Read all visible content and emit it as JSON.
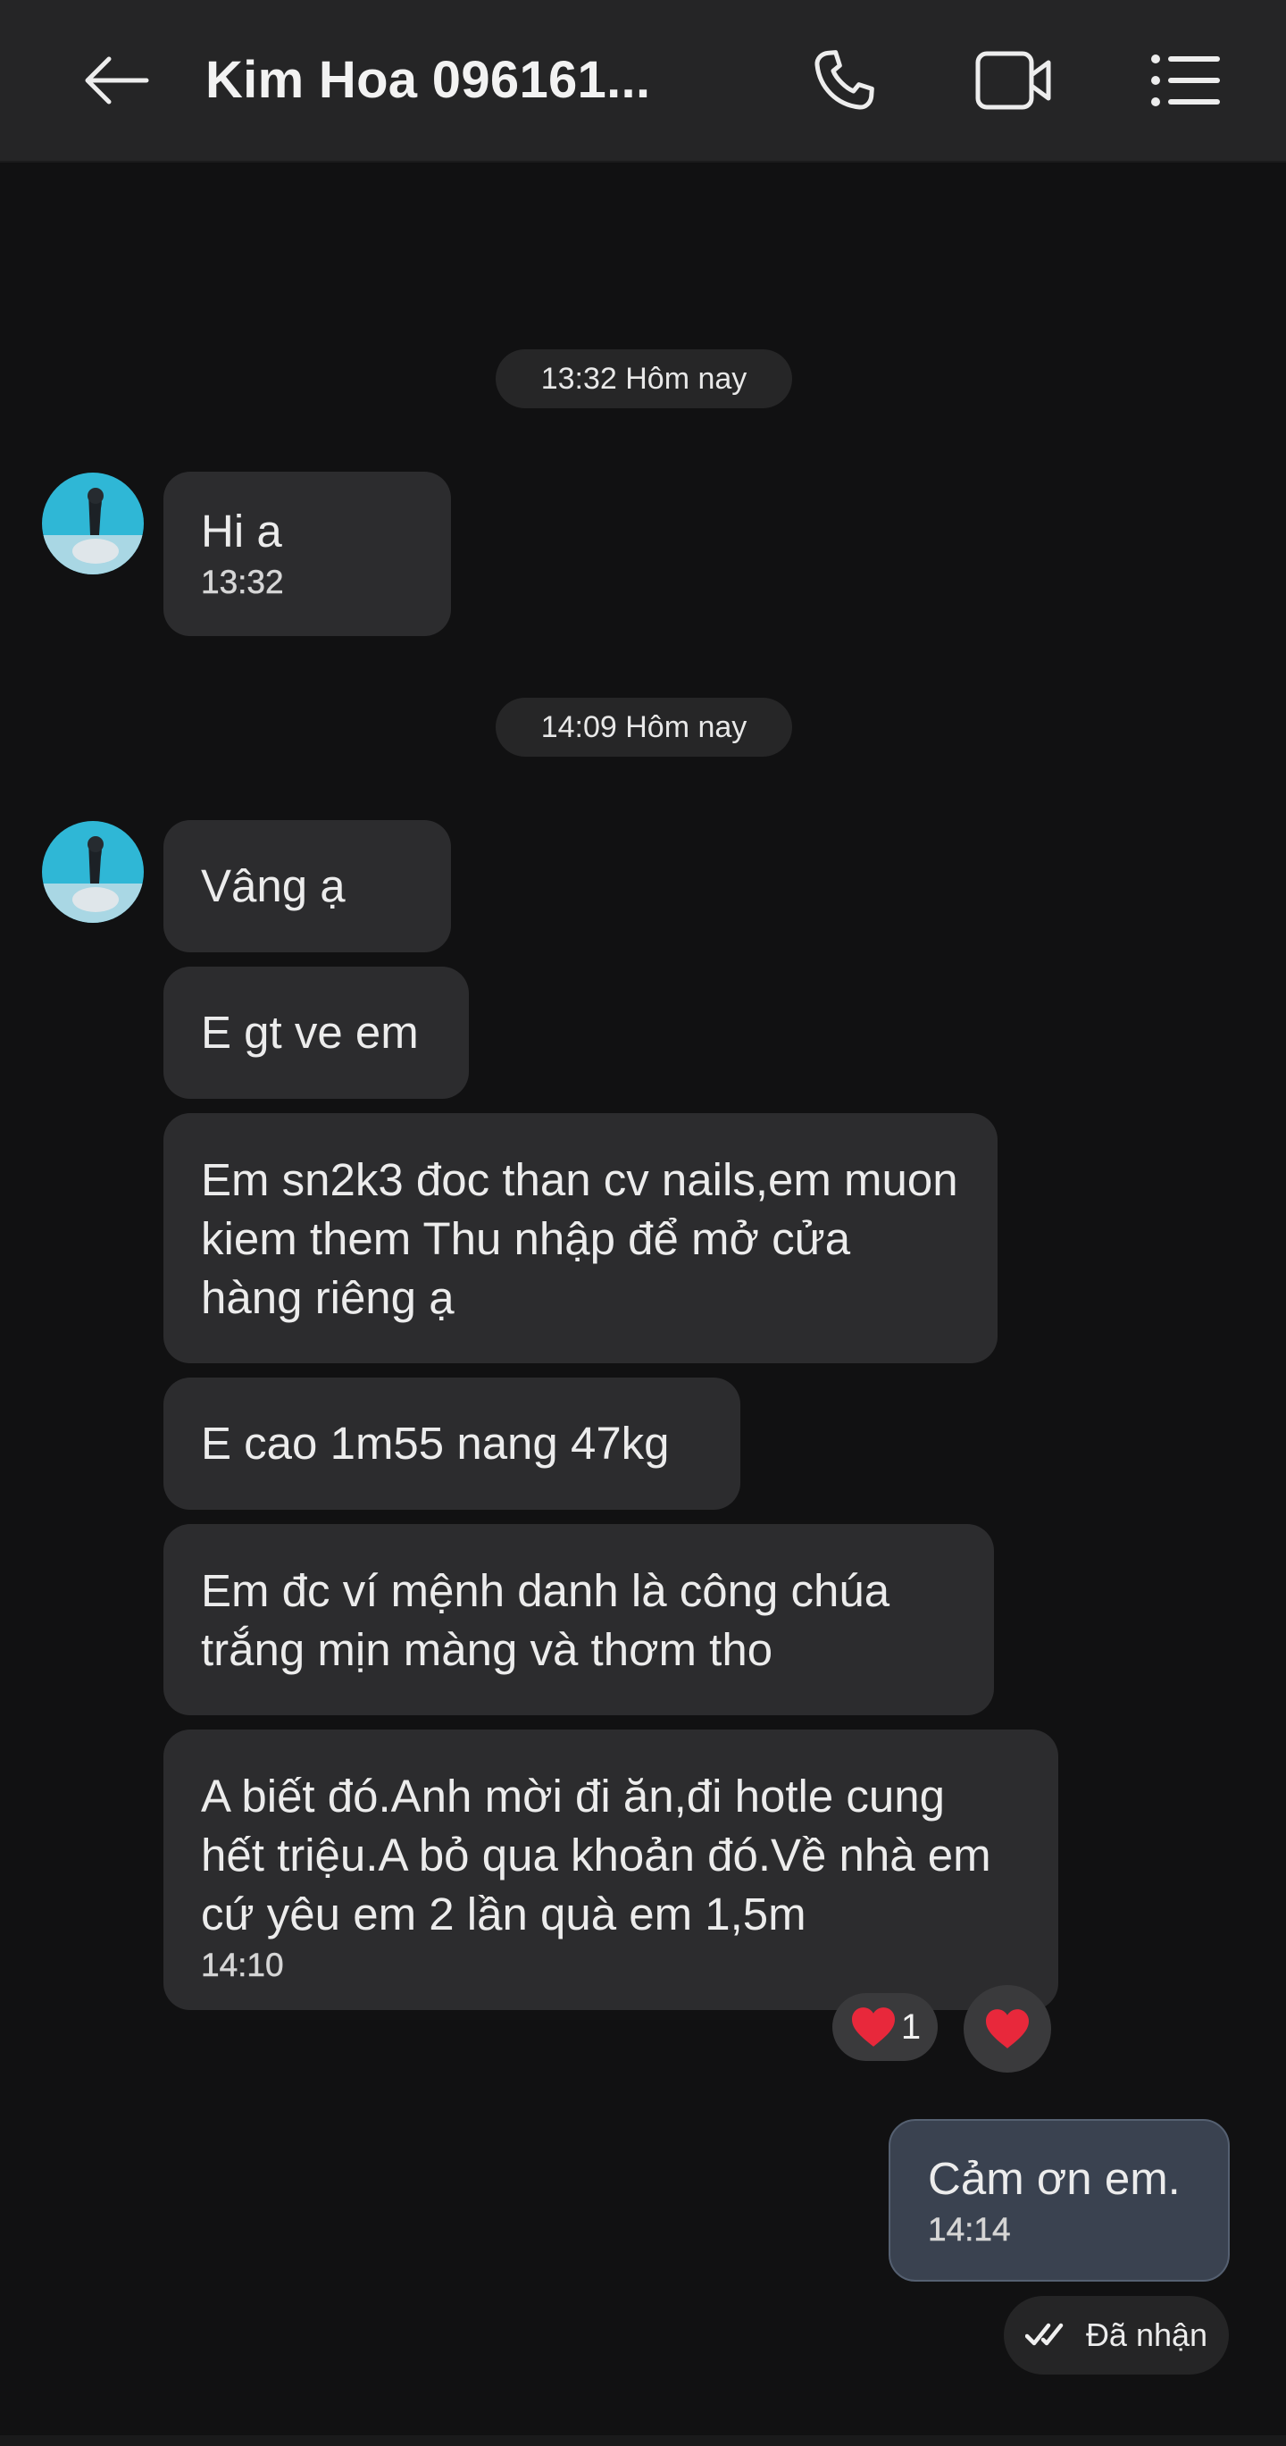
{
  "header": {
    "title": "Kim Hoa 096161...",
    "back_icon": "arrow-left-icon",
    "call_icon": "phone-icon",
    "video_icon": "video-camera-icon",
    "menu_icon": "list-menu-icon"
  },
  "separators": [
    "13:32 Hôm nay",
    "14:09 Hôm nay"
  ],
  "messages": [
    {
      "text": "Hi a",
      "time": "13:32"
    },
    {
      "text": "Vâng ạ"
    },
    {
      "text": "E gt ve em"
    },
    {
      "text": "Em sn2k3 đoc than cv nails,em muon kiem them Thu nhập để mở cửa hàng riêng ạ"
    },
    {
      "text": "E cao 1m55 nang 47kg"
    },
    {
      "text": "Em đc ví mệnh danh là công chúa trắng mịn màng và thơm tho"
    },
    {
      "text": "A biết đó.Anh mời đi ăn,đi hotle cung hết triệu.A bỏ qua khoản đó.Về nhà em cứ yêu em 2 lần quà em 1,5m",
      "time": "14:10"
    }
  ],
  "reactions": {
    "summary_icon": "heart-icon",
    "count": "1",
    "add_icon": "heart-icon"
  },
  "outgoing": {
    "text": "Cảm ơn em.",
    "time": "14:14"
  },
  "status": {
    "icon": "double-check-icon",
    "label": "Đã nhận"
  },
  "colors": {
    "header_bg": "#252526",
    "screen_bg": "#111112",
    "incoming_bubble": "#2c2c2e",
    "outgoing_bubble": "#3a4250",
    "heart": "#e8283b"
  }
}
